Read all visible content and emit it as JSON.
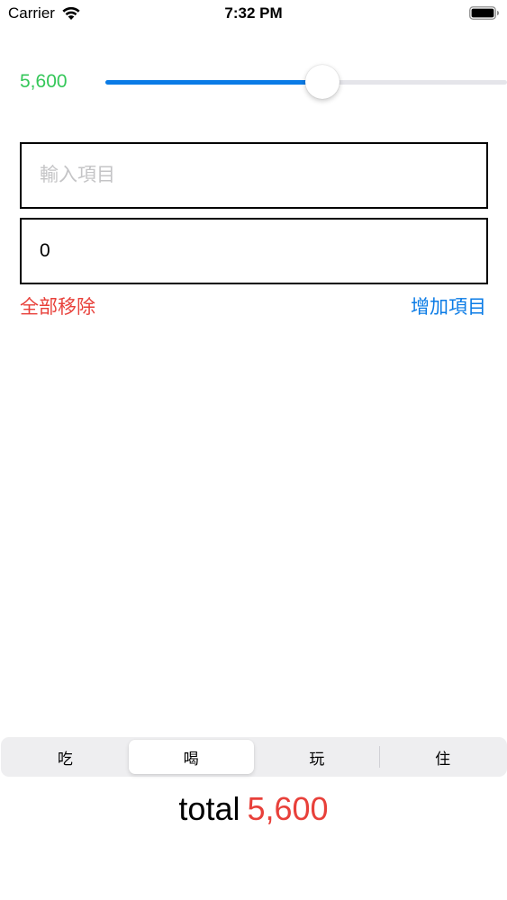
{
  "status_bar": {
    "carrier": "Carrier",
    "time": "7:32 PM",
    "icons": [
      "wifi-icon",
      "battery-icon"
    ]
  },
  "slider": {
    "value_label": "5,600",
    "fill_fraction": 0.54,
    "value_color": "#34c759",
    "track_color": "#0a7be6"
  },
  "item_input": {
    "value": "",
    "placeholder": "輸入項目"
  },
  "amount_input": {
    "value": "0",
    "placeholder": ""
  },
  "actions": {
    "remove_all_label": "全部移除",
    "add_item_label": "增加項目",
    "remove_color": "#e8403a",
    "add_color": "#0a7be6"
  },
  "segments": {
    "items": [
      {
        "label": "吃"
      },
      {
        "label": "喝"
      },
      {
        "label": "玩"
      },
      {
        "label": "住"
      }
    ],
    "selected": "喝"
  },
  "total": {
    "label": "total",
    "value": "5,600",
    "value_color": "#e8403a"
  }
}
